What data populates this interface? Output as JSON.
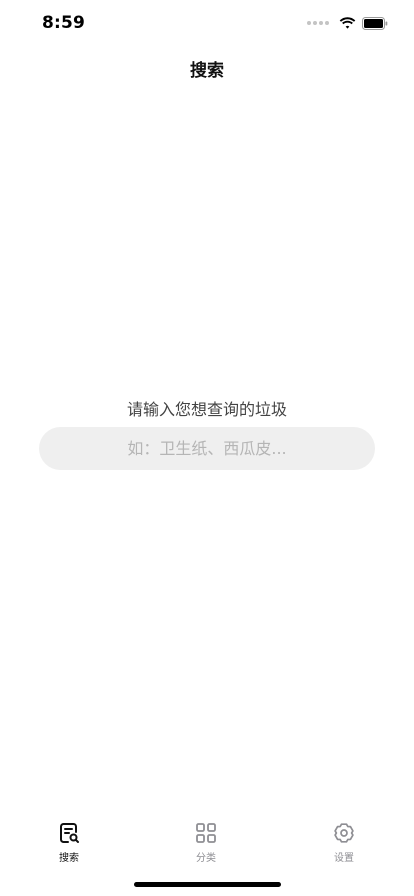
{
  "status_bar": {
    "time": "8:59"
  },
  "nav": {
    "title": "搜索"
  },
  "search": {
    "prompt": "请输入您想查询的垃圾",
    "placeholder": "如：卫生纸、西瓜皮...",
    "value": ""
  },
  "tab_bar": {
    "tabs": [
      {
        "label": "搜索",
        "icon": "search-document-icon",
        "active": true
      },
      {
        "label": "分类",
        "icon": "grid-icon",
        "active": false
      },
      {
        "label": "设置",
        "icon": "gear-icon",
        "active": false
      }
    ]
  },
  "colors": {
    "background": "#ffffff",
    "input_background": "#efefef",
    "placeholder": "#b5b5b5",
    "active_tab": "#111111",
    "inactive_tab": "#8e8e93"
  }
}
